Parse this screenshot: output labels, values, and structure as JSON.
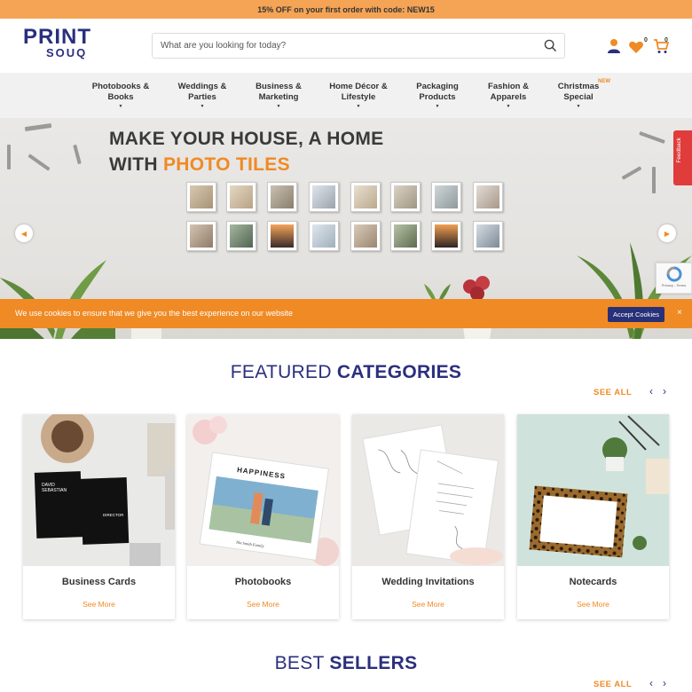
{
  "promo": {
    "text": "15% OFF on your first order with code: NEW15"
  },
  "header": {
    "logo_top": "PRINT",
    "logo_bottom": "SOUQ",
    "search_placeholder": "What are you looking for today?",
    "wishlist_count": "0",
    "cart_count": "0"
  },
  "nav": {
    "items": [
      {
        "line1": "Photobooks &",
        "line2": "Books"
      },
      {
        "line1": "Weddings &",
        "line2": "Parties"
      },
      {
        "line1": "Business &",
        "line2": "Marketing"
      },
      {
        "line1": "Home Décor &",
        "line2": "Lifestyle"
      },
      {
        "line1": "Packaging",
        "line2": "Products"
      },
      {
        "line1": "Fashion &",
        "line2": "Apparels"
      },
      {
        "line1": "Christmas",
        "line2": "Special",
        "tag": "NEW"
      }
    ]
  },
  "banner": {
    "title_line1": "MAKE YOUR HOUSE, A HOME",
    "title_line2_prefix": "WITH ",
    "title_line2_accent": "PHOTO TILES",
    "accent_color": "#f08a24"
  },
  "feedback": {
    "label": "Feedback"
  },
  "recaptcha": {
    "label": "Privacy - Terms"
  },
  "cookie": {
    "message": "We use cookies to ensure that we give you the best experience on our website",
    "accept_label": "Accept Cookies",
    "close_label": "×"
  },
  "featured": {
    "title_light": "FEATURED ",
    "title_bold": "CATEGORIES",
    "see_all": "SEE ALL",
    "cards": [
      {
        "name": "Business Cards",
        "link": "See More",
        "card_text": [
          "DAVID",
          "SEBASTIAN",
          "DIRECTOR"
        ]
      },
      {
        "name": "Photobooks",
        "link": "See More",
        "card_text": [
          "HAPPINESS",
          "The Smith Family"
        ]
      },
      {
        "name": "Wedding Invitations",
        "link": "See More"
      },
      {
        "name": "Notecards",
        "link": "See More"
      }
    ]
  },
  "bestsellers": {
    "title_light": "BEST ",
    "title_bold": "SELLERS",
    "see_all": "SEE ALL"
  },
  "colors": {
    "brand_navy": "#2b2f7d",
    "brand_orange": "#f08a24",
    "promo_bg": "#f5a455"
  }
}
